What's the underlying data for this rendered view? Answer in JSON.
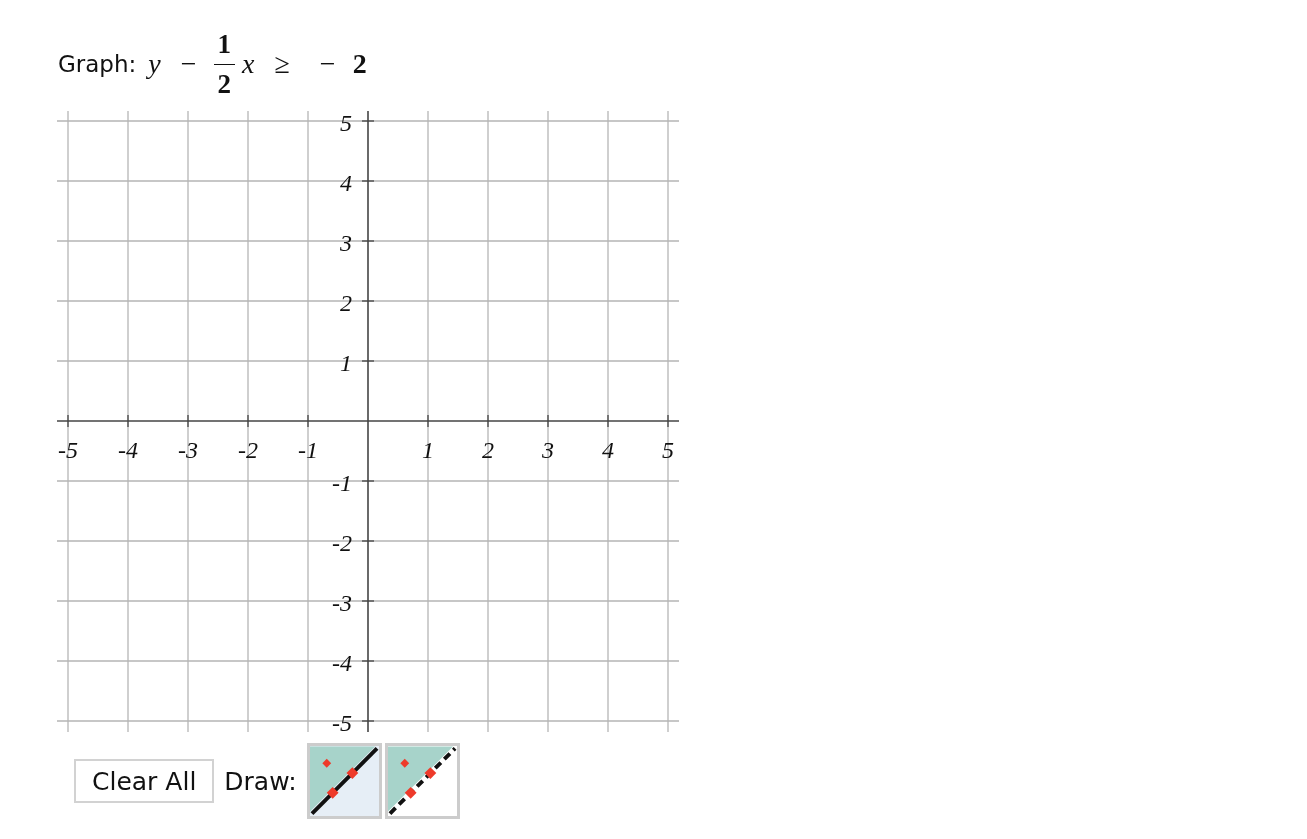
{
  "prompt": {
    "label": "Graph:",
    "inequality": [
      {
        "kind": "var",
        "text": "y"
      },
      {
        "kind": "op",
        "text": "−"
      },
      {
        "kind": "frac",
        "num": "1",
        "den": "2"
      },
      {
        "kind": "var",
        "text": "x"
      },
      {
        "kind": "op",
        "text": "≥"
      },
      {
        "kind": "op",
        "text": "−"
      },
      {
        "kind": "num",
        "text": "2"
      }
    ]
  },
  "plane": {
    "x_labels": [
      "-5",
      "-4",
      "-3",
      "-2",
      "-1",
      "1",
      "2",
      "3",
      "4",
      "5"
    ],
    "y_labels": [
      "5",
      "4",
      "3",
      "2",
      "1",
      "-1",
      "-2",
      "-3",
      "-4",
      "-5"
    ]
  },
  "toolbar": {
    "clear_button": "Clear All",
    "draw_label": "Draw:",
    "tools": [
      {
        "kind": "solid",
        "selected": true
      },
      {
        "kind": "dashed",
        "selected": false
      }
    ]
  }
}
